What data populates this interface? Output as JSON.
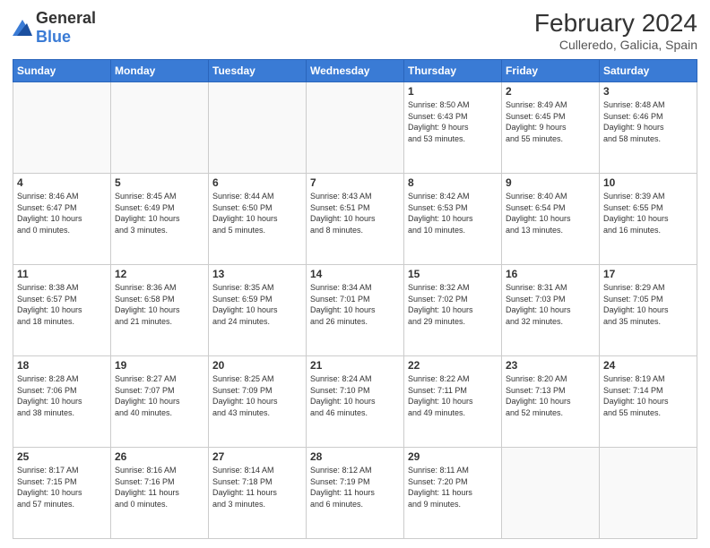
{
  "header": {
    "logo": {
      "general": "General",
      "blue": "Blue"
    },
    "title": "February 2024",
    "location": "Culleredo, Galicia, Spain"
  },
  "weekdays": [
    "Sunday",
    "Monday",
    "Tuesday",
    "Wednesday",
    "Thursday",
    "Friday",
    "Saturday"
  ],
  "weeks": [
    [
      {
        "day": "",
        "info": ""
      },
      {
        "day": "",
        "info": ""
      },
      {
        "day": "",
        "info": ""
      },
      {
        "day": "",
        "info": ""
      },
      {
        "day": "1",
        "info": "Sunrise: 8:50 AM\nSunset: 6:43 PM\nDaylight: 9 hours\nand 53 minutes."
      },
      {
        "day": "2",
        "info": "Sunrise: 8:49 AM\nSunset: 6:45 PM\nDaylight: 9 hours\nand 55 minutes."
      },
      {
        "day": "3",
        "info": "Sunrise: 8:48 AM\nSunset: 6:46 PM\nDaylight: 9 hours\nand 58 minutes."
      }
    ],
    [
      {
        "day": "4",
        "info": "Sunrise: 8:46 AM\nSunset: 6:47 PM\nDaylight: 10 hours\nand 0 minutes."
      },
      {
        "day": "5",
        "info": "Sunrise: 8:45 AM\nSunset: 6:49 PM\nDaylight: 10 hours\nand 3 minutes."
      },
      {
        "day": "6",
        "info": "Sunrise: 8:44 AM\nSunset: 6:50 PM\nDaylight: 10 hours\nand 5 minutes."
      },
      {
        "day": "7",
        "info": "Sunrise: 8:43 AM\nSunset: 6:51 PM\nDaylight: 10 hours\nand 8 minutes."
      },
      {
        "day": "8",
        "info": "Sunrise: 8:42 AM\nSunset: 6:53 PM\nDaylight: 10 hours\nand 10 minutes."
      },
      {
        "day": "9",
        "info": "Sunrise: 8:40 AM\nSunset: 6:54 PM\nDaylight: 10 hours\nand 13 minutes."
      },
      {
        "day": "10",
        "info": "Sunrise: 8:39 AM\nSunset: 6:55 PM\nDaylight: 10 hours\nand 16 minutes."
      }
    ],
    [
      {
        "day": "11",
        "info": "Sunrise: 8:38 AM\nSunset: 6:57 PM\nDaylight: 10 hours\nand 18 minutes."
      },
      {
        "day": "12",
        "info": "Sunrise: 8:36 AM\nSunset: 6:58 PM\nDaylight: 10 hours\nand 21 minutes."
      },
      {
        "day": "13",
        "info": "Sunrise: 8:35 AM\nSunset: 6:59 PM\nDaylight: 10 hours\nand 24 minutes."
      },
      {
        "day": "14",
        "info": "Sunrise: 8:34 AM\nSunset: 7:01 PM\nDaylight: 10 hours\nand 26 minutes."
      },
      {
        "day": "15",
        "info": "Sunrise: 8:32 AM\nSunset: 7:02 PM\nDaylight: 10 hours\nand 29 minutes."
      },
      {
        "day": "16",
        "info": "Sunrise: 8:31 AM\nSunset: 7:03 PM\nDaylight: 10 hours\nand 32 minutes."
      },
      {
        "day": "17",
        "info": "Sunrise: 8:29 AM\nSunset: 7:05 PM\nDaylight: 10 hours\nand 35 minutes."
      }
    ],
    [
      {
        "day": "18",
        "info": "Sunrise: 8:28 AM\nSunset: 7:06 PM\nDaylight: 10 hours\nand 38 minutes."
      },
      {
        "day": "19",
        "info": "Sunrise: 8:27 AM\nSunset: 7:07 PM\nDaylight: 10 hours\nand 40 minutes."
      },
      {
        "day": "20",
        "info": "Sunrise: 8:25 AM\nSunset: 7:09 PM\nDaylight: 10 hours\nand 43 minutes."
      },
      {
        "day": "21",
        "info": "Sunrise: 8:24 AM\nSunset: 7:10 PM\nDaylight: 10 hours\nand 46 minutes."
      },
      {
        "day": "22",
        "info": "Sunrise: 8:22 AM\nSunset: 7:11 PM\nDaylight: 10 hours\nand 49 minutes."
      },
      {
        "day": "23",
        "info": "Sunrise: 8:20 AM\nSunset: 7:13 PM\nDaylight: 10 hours\nand 52 minutes."
      },
      {
        "day": "24",
        "info": "Sunrise: 8:19 AM\nSunset: 7:14 PM\nDaylight: 10 hours\nand 55 minutes."
      }
    ],
    [
      {
        "day": "25",
        "info": "Sunrise: 8:17 AM\nSunset: 7:15 PM\nDaylight: 10 hours\nand 57 minutes."
      },
      {
        "day": "26",
        "info": "Sunrise: 8:16 AM\nSunset: 7:16 PM\nDaylight: 11 hours\nand 0 minutes."
      },
      {
        "day": "27",
        "info": "Sunrise: 8:14 AM\nSunset: 7:18 PM\nDaylight: 11 hours\nand 3 minutes."
      },
      {
        "day": "28",
        "info": "Sunrise: 8:12 AM\nSunset: 7:19 PM\nDaylight: 11 hours\nand 6 minutes."
      },
      {
        "day": "29",
        "info": "Sunrise: 8:11 AM\nSunset: 7:20 PM\nDaylight: 11 hours\nand 9 minutes."
      },
      {
        "day": "",
        "info": ""
      },
      {
        "day": "",
        "info": ""
      }
    ]
  ]
}
